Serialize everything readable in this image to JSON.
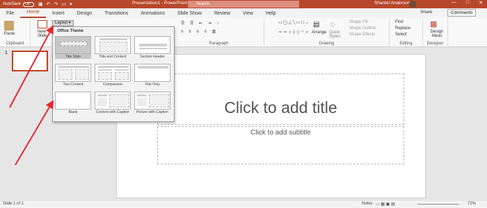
{
  "titlebar": {
    "autosave_label": "AutoSave",
    "autosave_state": "Off",
    "doc_title": "Presentation1 - PowerPoint",
    "search_placeholder": "Search",
    "user_name": "Shantel Anderson",
    "minimize": "—",
    "maximize": "□",
    "close": "✕"
  },
  "tabs": [
    "File",
    "Home",
    "Insert",
    "Design",
    "Transitions",
    "Animations",
    "Slide Show",
    "Review",
    "View",
    "Help"
  ],
  "tab_active_index": 1,
  "share_label": "Share",
  "comments_label": "Comments",
  "ribbon": {
    "paste_label": "Paste",
    "clipboard_label": "Clipboard",
    "new_slide_label": "New Slide",
    "layout_label": "Layout",
    "paragraph_label": "Paragraph",
    "drawing_label": "Drawing",
    "arrange_label": "Arrange",
    "quick_styles_label": "Quick Styles",
    "shape_fill_label": "Shape Fill",
    "shape_outline_label": "Shape Outline",
    "shape_effects_label": "Shape Effects",
    "find_label": "Find",
    "replace_label": "Replace",
    "select_label": "Select",
    "editing_label": "Editing",
    "design_ideas_label": "Design Ideas",
    "designer_label": "Designer"
  },
  "layout_panel": {
    "heading": "Office Theme",
    "layouts": [
      "Title Slide",
      "Title and Content",
      "Section Header",
      "Two Content",
      "Comparison",
      "Title Only",
      "Blank",
      "Content with Caption",
      "Picture with Caption"
    ],
    "selected_index": 0
  },
  "slide_panel": {
    "slide_number": "1"
  },
  "slide": {
    "title_placeholder": "Click to add title",
    "subtitle_placeholder": "Click to add subtitle"
  },
  "statusbar": {
    "slide_info": "Slide 1 of 1",
    "notes_label": "Notes",
    "zoom": "72%"
  },
  "colors": {
    "accent": "#b7472a",
    "arrow": "#e8262c"
  }
}
